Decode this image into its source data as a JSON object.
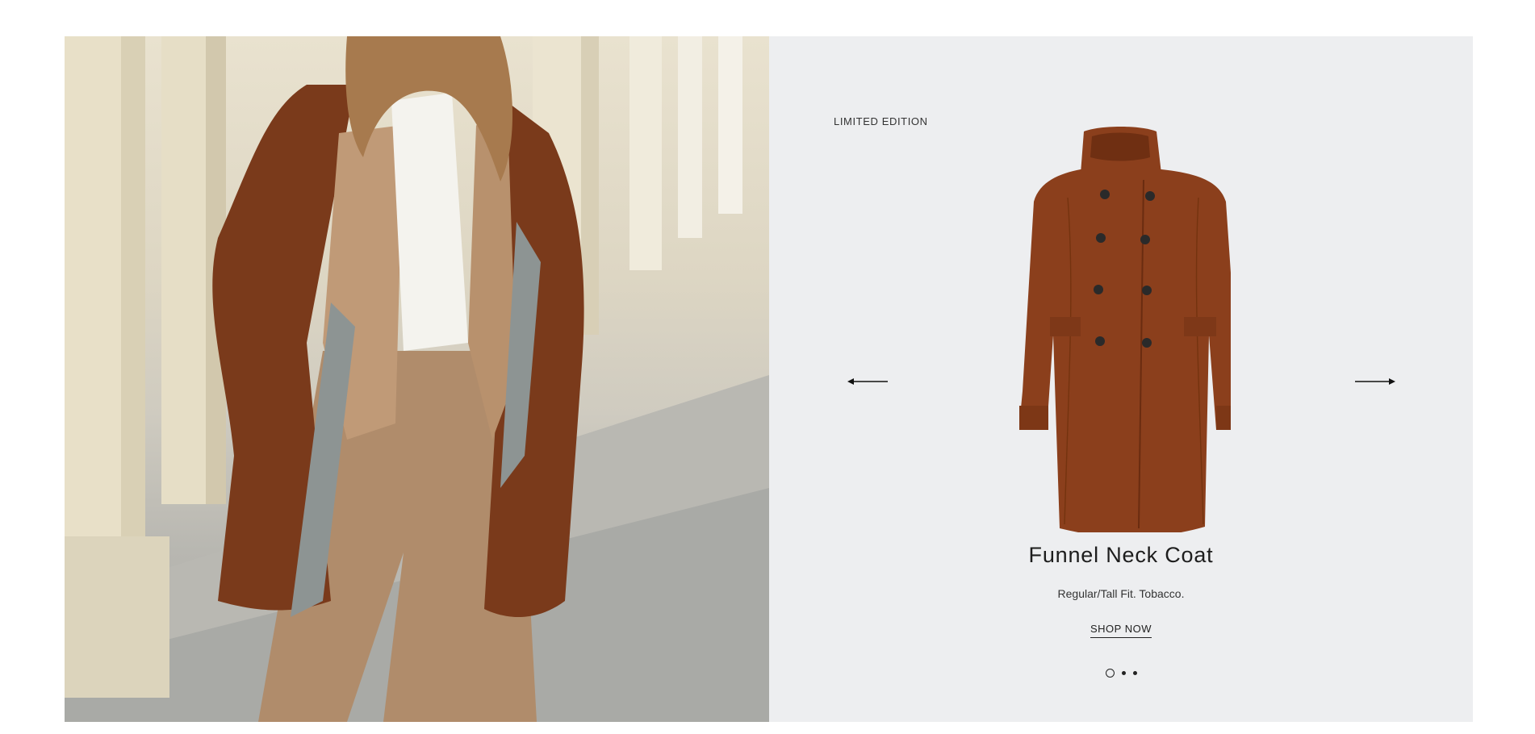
{
  "hero": {
    "image_alt": "Model wearing brown coat",
    "product_image_alt": "Funnel Neck Coat",
    "eyebrow": "LIMITED EDITION",
    "title": "Funnel Neck Coat",
    "subtitle": "Regular/Tall Fit. Tobacco.",
    "cta_label": "SHOP NOW",
    "prev_icon": "arrow-left-icon",
    "next_icon": "arrow-right-icon",
    "slides": {
      "total": 3,
      "active": 1
    }
  },
  "colors": {
    "panel_bg": "#edeef0",
    "coat": "#8b3f1c",
    "text": "#222222"
  }
}
